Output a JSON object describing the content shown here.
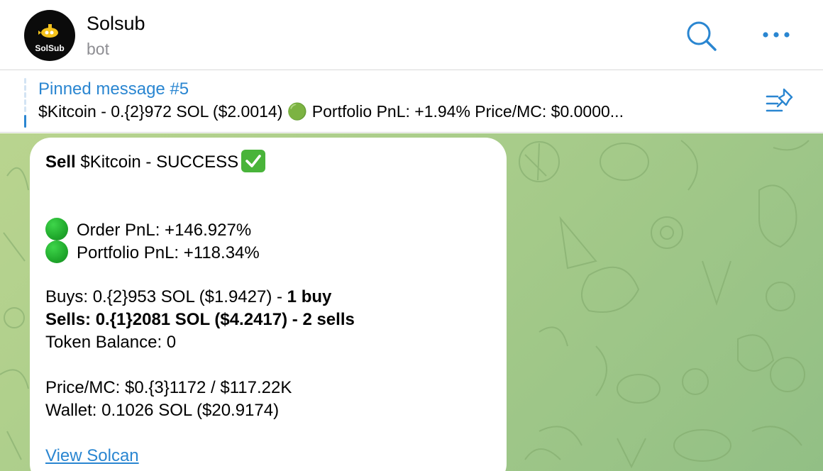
{
  "header": {
    "title": "Solsub",
    "subtitle": "bot",
    "avatar_text": "SolSub"
  },
  "pinned": {
    "title": "Pinned message #5",
    "text": "$Kitcoin - 0.{2}972 SOL ($2.0014) 🟢 Portfolio PnL: +1.94%  Price/MC: $0.0000..."
  },
  "message": {
    "headline_action": "Sell",
    "headline_rest": " $Kitcoin - SUCCESS",
    "order_pnl": "Order PnL: +146.927%",
    "portfolio_pnl": "Portfolio PnL: +118.34%",
    "buys_text": "Buys: 0.{2}953 SOL ($1.9427) - ",
    "buys_count": "1 buy",
    "sells": "Sells: 0.{1}2081 SOL ($4.2417) - 2 sells",
    "token_balance": "Token Balance: 0",
    "price_mc": "Price/MC: $0.{3}1172 / $117.22K",
    "wallet": "Wallet: 0.1026 SOL ($20.9174)",
    "link": "View Solcan"
  },
  "colors": {
    "accent": "#2a86d1",
    "status_green": "#20a92c",
    "check_green": "#49b43a"
  },
  "icons": [
    "search-icon",
    "more-icon",
    "pinned-list-icon",
    "green-circle-icon",
    "check-mark-icon"
  ]
}
